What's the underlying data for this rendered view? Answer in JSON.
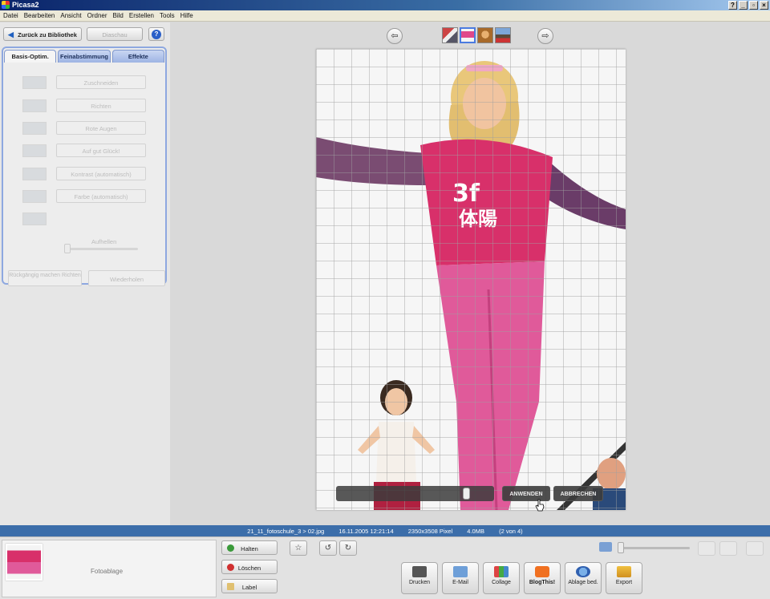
{
  "window": {
    "title": "Picasa2",
    "controls": [
      "?",
      "_",
      "▫",
      "×"
    ]
  },
  "menu": [
    "Datei",
    "Bearbeiten",
    "Ansicht",
    "Ordner",
    "Bild",
    "Erstellen",
    "Tools",
    "Hilfe"
  ],
  "left": {
    "back_label": "Zurück zu Bibliothek",
    "slideshow_label": "Diaschau",
    "help_label": "?",
    "tabs": [
      "Basis-Optim.",
      "Feinabstimmung",
      "Effekte"
    ],
    "tools": [
      "Zuschneiden",
      "Richten",
      "Rote Augen",
      "Auf gut Glück!",
      "Kontrast (automatisch)",
      "Farbe (automatisch)"
    ],
    "fill_label": "Aufhellen",
    "undo_label": "Rückgängig machen Richten",
    "redo_label": "Wiederholen"
  },
  "viewer": {
    "prev_icon": "arrow-left-icon",
    "next_icon": "arrow-right-icon",
    "apply_label": "ANWENDEN",
    "cancel_label": "ABBRECHEN",
    "straighten_value": 0.85
  },
  "info": {
    "path": "21_11_fotoschule_3 > 02.jpg",
    "date": "16.11.2005 12:21:14",
    "dimensions": "2350x3508 Pixel",
    "size": "4.0MB",
    "position": "(2 von 4)"
  },
  "bottom": {
    "tray_label": "Fotoablage",
    "hold_label": "Halten",
    "delete_label": "Löschen",
    "label_label": "Label",
    "actions": [
      "Drucken",
      "E-Mail",
      "Collage",
      "BlogThis!",
      "Ablage bed.",
      "Export"
    ]
  },
  "colors": {
    "accent": "#3c6eaa",
    "tab_border": "#8ea8e0",
    "title": "#0a246a"
  }
}
